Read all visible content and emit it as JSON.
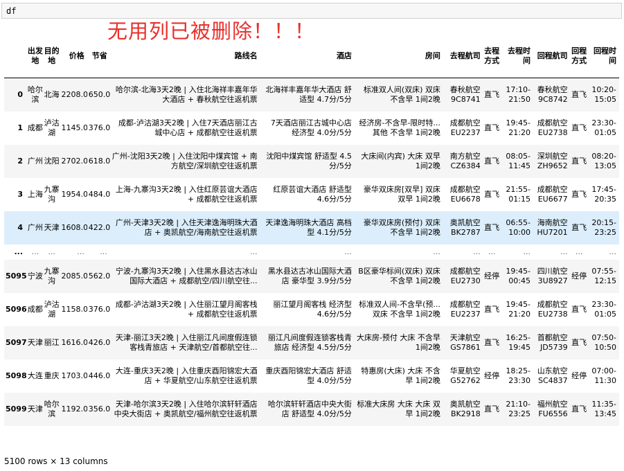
{
  "cell": {
    "code": "df"
  },
  "annotation": "无用列已被删除！！！",
  "columns": [
    "",
    "出发地",
    "目的地",
    "价格",
    "节省",
    "路线名",
    "酒店",
    "房间",
    "去程航司",
    "去程方式",
    "去程时间",
    "回程航司",
    "回程方式",
    "回程时间"
  ],
  "rows_top": [
    [
      "0",
      "哈尔滨",
      "北海",
      "2208.0",
      "650.0",
      "哈尔滨-北海3天2晚 | 入住北海祥丰嘉年华大酒店 + 春秋航空往返机票",
      "北海祥丰嘉年华大酒店 舒适型 4.7分/5分",
      "标准双人间(双床) 双床 不含早 1间2晚",
      "春秋航空 9C8741",
      "直飞",
      "17:10-21:50",
      "春秋航空 9C8742",
      "直飞",
      "10:20-15:05"
    ],
    [
      "1",
      "成都",
      "泸沽湖",
      "1145.0",
      "376.0",
      "成都-泸沽湖3天2晚 | 入住7天酒店丽江古城中心店 + 成都航空往返机票",
      "7天酒店丽江古城中心店 经济型 4.0分/5分",
      "经济房-不含早-限时特... 其他 不含早 1间2晚",
      "成都航空 EU2237",
      "直飞",
      "19:45-21:20",
      "成都航空 EU2738",
      "直飞",
      "23:30-01:05"
    ],
    [
      "2",
      "广州",
      "沈阳",
      "2702.0",
      "618.0",
      "广州-沈阳3天2晚 | 入住沈阳中煤宾馆 + 南方航空/深圳航空往返机票",
      "沈阳中煤宾馆 舒适型 4.5分/5分",
      "大床间(内宾) 大床 双早 1间2晚",
      "南方航空 CZ6384",
      "直飞",
      "08:05-11:45",
      "深圳航空 ZH9652",
      "直飞",
      "08:20-13:05"
    ],
    [
      "3",
      "上海",
      "九寨沟",
      "1954.0",
      "484.0",
      "上海-九寨沟3天2晚 | 入住红原芸谊大酒店 + 成都航空往返机票",
      "红原芸谊大酒店 舒适型 4.6分/5分",
      "豪华双床房[双早] 双床 双早 1间2晚",
      "成都航空 EU6678",
      "直飞",
      "21:55-01:15",
      "成都航空 EU6677",
      "直飞",
      "17:45-20:35"
    ],
    [
      "4",
      "广州",
      "天津",
      "1608.0",
      "422.0",
      "广州-天津3天2晚 | 入住天津逸海明珠大酒店 + 奥凯航空/海南航空往返机票",
      "天津逸海明珠大酒店 高档型 4.1分/5分",
      "豪华双床房(预付) 双床 不含早 1间2晚",
      "奥凯航空 BK2787",
      "直飞",
      "06:55-10:00",
      "海南航空 HU7201",
      "直飞",
      "20:15-23:25"
    ]
  ],
  "ellipsis": [
    "...",
    "...",
    "...",
    "...",
    "...",
    "...",
    "...",
    "...",
    "...",
    "...",
    "...",
    "...",
    "...",
    "..."
  ],
  "rows_bottom": [
    [
      "5095",
      "宁波",
      "九寨沟",
      "2085.0",
      "562.0",
      "宁波-九寨沟3天2晚 | 入住黑水县达古冰山国际大酒店 + 成都航空/四川航空往...",
      "黑水县达古冰山国际大酒店 豪华型 3.9分/5分",
      "B区豪华标间(双床) 双床 不含早 1间2晚",
      "成都航空 EU2730",
      "经停",
      "19:45-00:45",
      "四川航空 3U8927",
      "经停",
      "07:55-12:15"
    ],
    [
      "5096",
      "成都",
      "泸沽湖",
      "1158.0",
      "376.0",
      "成都-泸沽湖3天2晚 | 入住丽江望月阁客栈 + 成都航空往返机票",
      "丽江望月阁客栈 经济型 4.6分/5分",
      "标准双人间-不含早(预... 双床 不含早 1间2晚",
      "成都航空 EU2237",
      "直飞",
      "19:45-21:20",
      "成都航空 EU2738",
      "直飞",
      "23:30-01:05"
    ],
    [
      "5097",
      "天津",
      "丽江",
      "1616.0",
      "426.0",
      "天津-丽江3天2晚 | 入住丽江凡间度假连锁客栈青旅店 + 天津航空/首都航空往...",
      "丽江凡间度假连锁客栈青旅店 经济型 4.5分/5分",
      "大床房-预付 大床 不含早 1间2晚",
      "天津航空 GS7861",
      "直飞",
      "16:25-19:45",
      "首都航空 JD5739",
      "直飞",
      "07:50-10:50"
    ],
    [
      "5098",
      "大连",
      "重庆",
      "1703.0",
      "446.0",
      "大连-重庆3天2晚 | 入住重庆酉阳锦宏大酒店 + 华夏航空/山东航空往返机票",
      "重庆酉阳锦宏大酒店 舒适型 4.0分/5分",
      "特惠房(大床) 大床 不含早 1间2晚",
      "华夏航空 G52762",
      "经停",
      "18:25-23:30",
      "山东航空 SC4837",
      "经停",
      "07:00-11:30"
    ],
    [
      "5099",
      "天津",
      "哈尔滨",
      "1192.0",
      "356.0",
      "天津-哈尔滨3天2晚 | 入住哈尔滨轩轩酒店中央大街店 + 奥凯航空/福州航空往返机票",
      "哈尔滨轩轩酒店中央大街店 舒适型 4.0分/5分",
      "标准大床房 大床 大床 双早 1间2晚",
      "奥凯航空 BK2918",
      "直飞",
      "21:10-23:25",
      "福州航空 FU6556",
      "直飞",
      "11:35-13:45"
    ]
  ],
  "footer": "5100 rows × 13 columns"
}
